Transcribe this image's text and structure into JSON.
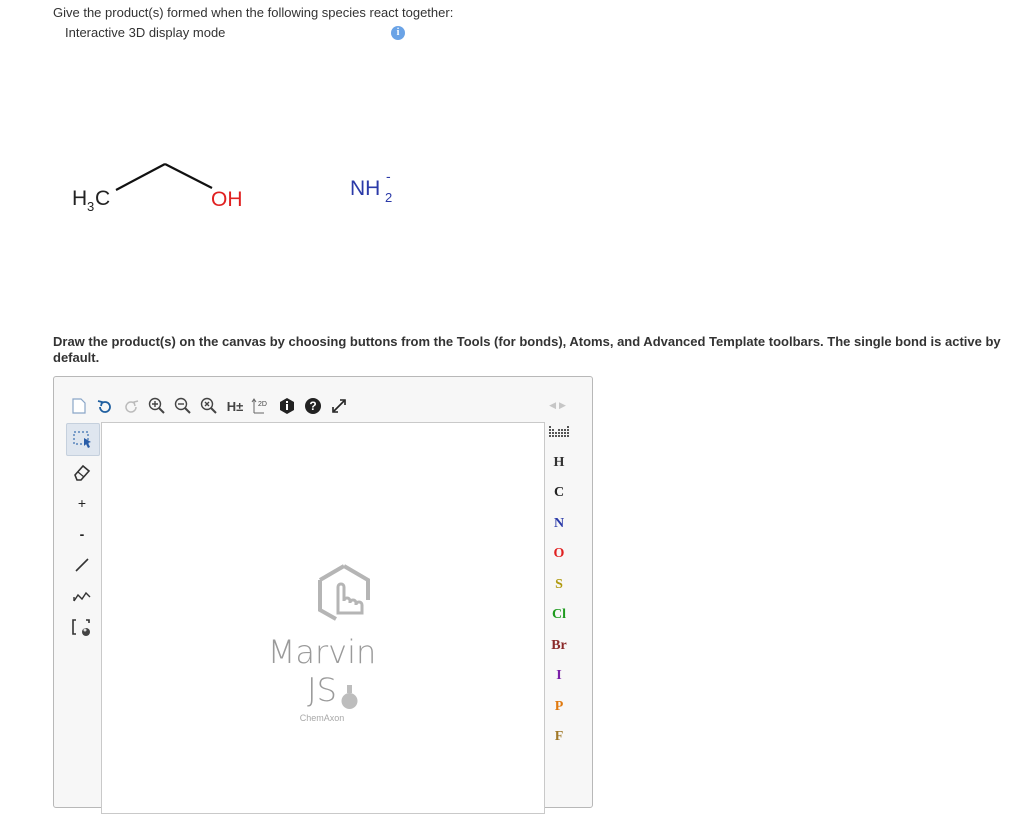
{
  "question": {
    "prompt": "Give the product(s) formed when the following species react together:",
    "mode_label": "Interactive 3D display mode",
    "info_glyph": "i"
  },
  "molecule": {
    "ch3_label": "H",
    "ch3_sub": "3",
    "ch3_c": "C",
    "oh_label": "OH",
    "nh2_label": "NH",
    "nh2_sub": "2",
    "nh2_charge": "-"
  },
  "instructions": "Draw the product(s) on the canvas by choosing buttons from the Tools (for bonds), Atoms, and Advanced Template toolbars. The single bond is active by default.",
  "toolbar": {
    "h_toggle_label": "H±",
    "clean_label": "2D",
    "help_glyph": "?"
  },
  "left_tools": {
    "plus_label": "+",
    "minus_label": "-"
  },
  "atoms": [
    {
      "symbol": "H",
      "color": "#333333"
    },
    {
      "symbol": "C",
      "color": "#222222"
    },
    {
      "symbol": "N",
      "color": "#2b3aa8"
    },
    {
      "symbol": "O",
      "color": "#e02020"
    },
    {
      "symbol": "S",
      "color": "#b09a10"
    },
    {
      "symbol": "Cl",
      "color": "#1e9a1e"
    },
    {
      "symbol": "Br",
      "color": "#8b2a2a"
    },
    {
      "symbol": "I",
      "color": "#7a1fa8"
    },
    {
      "symbol": "P",
      "color": "#e07a10"
    },
    {
      "symbol": "F",
      "color": "#a07828"
    }
  ],
  "canvas": {
    "brand": "Marvin JS",
    "sub_brand": "ChemAxon"
  },
  "colors": {
    "accent": "#6aa3e6",
    "nh2": "#2b3aa8",
    "oh": "#e02020"
  }
}
